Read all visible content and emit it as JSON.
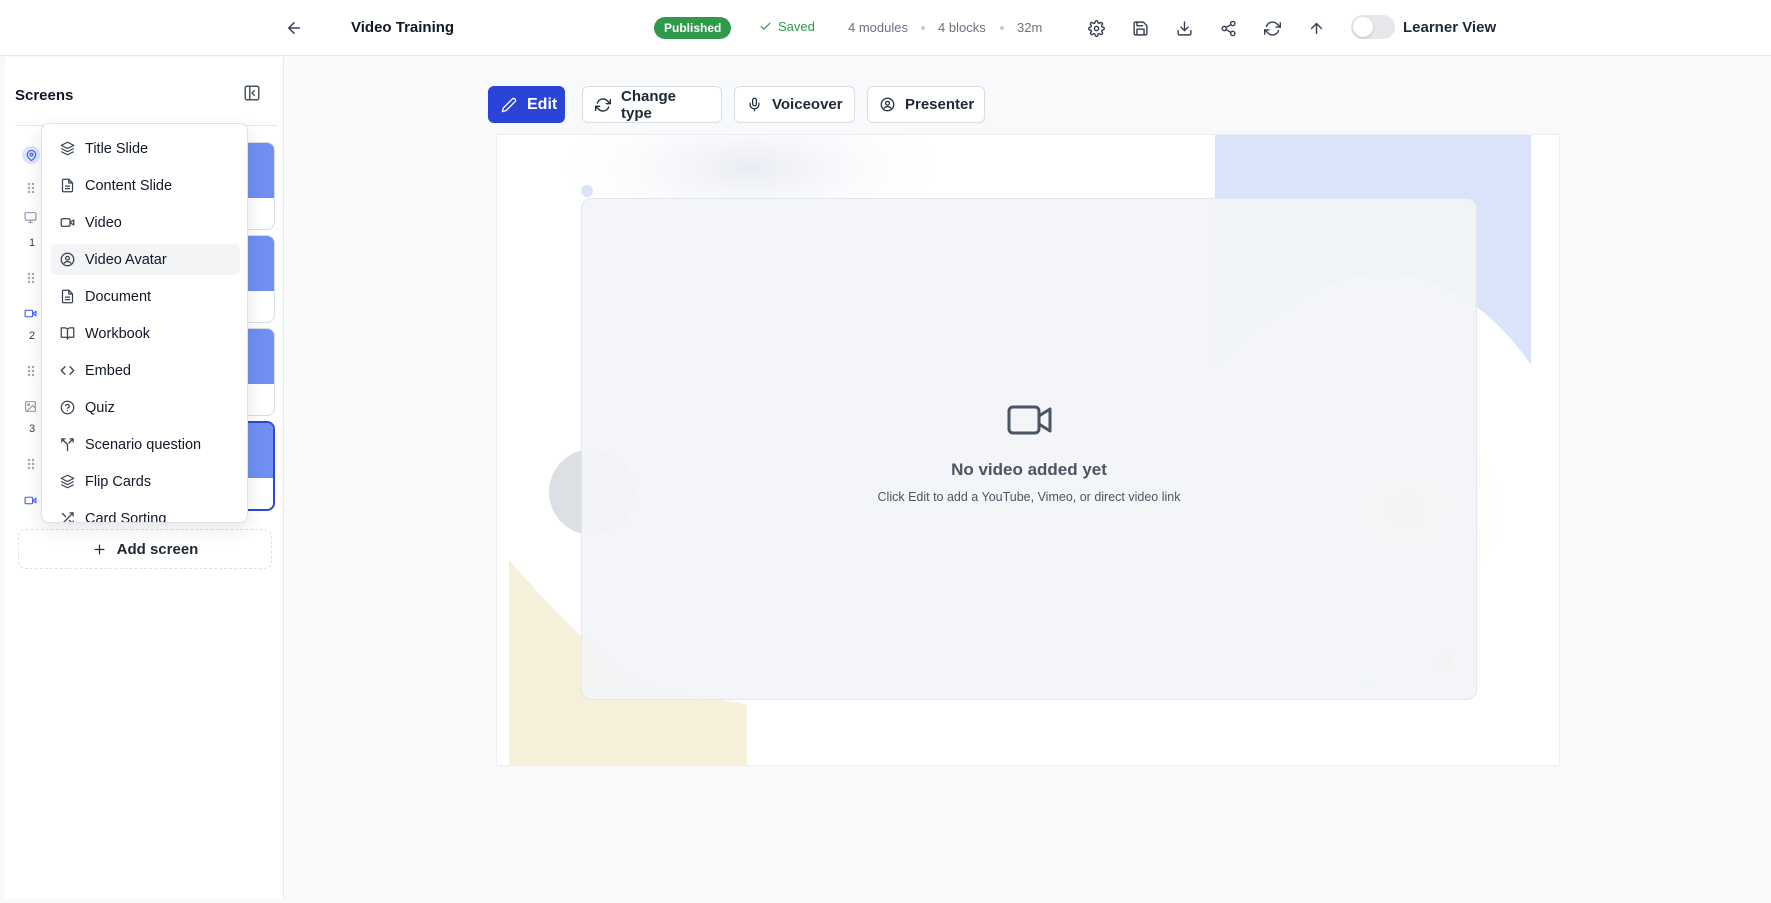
{
  "header": {
    "title": "Video Training",
    "status_badge": "Published",
    "saved_label": "Saved",
    "modules": "4 modules",
    "blocks": "4 blocks",
    "duration": "32m",
    "learner_view_label": "Learner View",
    "learner_view_on": false
  },
  "sidebar": {
    "title": "Screens",
    "screen_numbers": [
      "1",
      "2",
      "3"
    ],
    "add_screen_label": "Add screen"
  },
  "dropdown": {
    "items": [
      {
        "label": "Title Slide",
        "icon": "layers-icon"
      },
      {
        "label": "Content Slide",
        "icon": "file-text-icon"
      },
      {
        "label": "Video",
        "icon": "video-icon"
      },
      {
        "label": "Video Avatar",
        "icon": "user-circle-icon"
      },
      {
        "label": "Document",
        "icon": "file-text-icon"
      },
      {
        "label": "Workbook",
        "icon": "book-open-icon"
      },
      {
        "label": "Embed",
        "icon": "code-icon"
      },
      {
        "label": "Quiz",
        "icon": "help-circle-icon"
      },
      {
        "label": "Scenario question",
        "icon": "split-icon"
      },
      {
        "label": "Flip Cards",
        "icon": "layers-icon"
      },
      {
        "label": "Card Sorting",
        "icon": "shuffle-icon"
      }
    ],
    "highlighted": "Video Avatar"
  },
  "toolbar": {
    "edit_label": "Edit",
    "change_type_label": "Change type",
    "voiceover_label": "Voiceover",
    "presenter_label": "Presenter"
  },
  "video": {
    "empty_title": "No video added yet",
    "empty_hint": "Click Edit to add a YouTube, Vimeo, or direct video link"
  },
  "colors": {
    "accent": "#2b44d8",
    "published": "#2f9b4a",
    "thumb": "#6f8ff2"
  }
}
